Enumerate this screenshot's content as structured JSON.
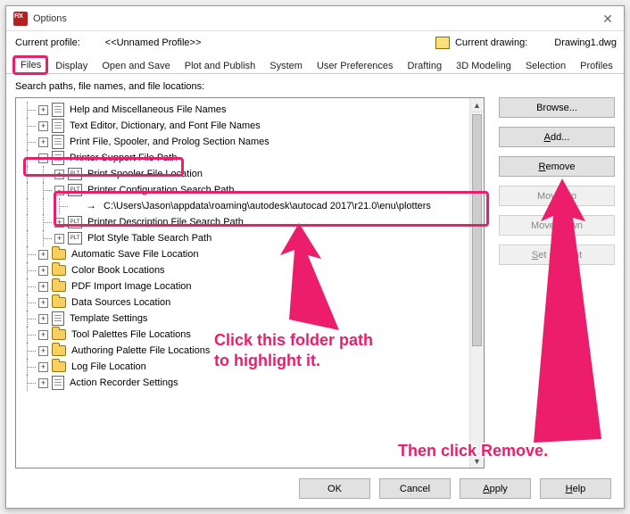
{
  "window": {
    "title": "Options"
  },
  "header": {
    "profile_label": "Current profile:",
    "profile_value": "<<Unnamed Profile>>",
    "drawing_label": "Current drawing:",
    "drawing_value": "Drawing1.dwg"
  },
  "tabs": {
    "items": [
      "Files",
      "Display",
      "Open and Save",
      "Plot and Publish",
      "System",
      "User Preferences",
      "Drafting",
      "3D Modeling",
      "Selection",
      "Profiles"
    ],
    "active": 0
  },
  "tree_label": "Search paths, file names, and file locations:",
  "tree": {
    "nodes": [
      {
        "depth": 0,
        "exp": "+",
        "icon": "doc",
        "label": "Help and Miscellaneous File Names"
      },
      {
        "depth": 0,
        "exp": "+",
        "icon": "doc",
        "label": "Text Editor, Dictionary, and Font File Names"
      },
      {
        "depth": 0,
        "exp": "+",
        "icon": "doc",
        "label": "Print File, Spooler, and Prolog Section Names"
      },
      {
        "depth": 0,
        "exp": "-",
        "icon": "doc",
        "label": "Printer Support File Path"
      },
      {
        "depth": 1,
        "exp": "+",
        "icon": "plt",
        "label": "Print Spooler File Location"
      },
      {
        "depth": 1,
        "exp": "-",
        "icon": "plt",
        "label": "Printer Configuration Search Path"
      },
      {
        "depth": 2,
        "exp": "",
        "icon": "arrow",
        "label": "C:\\Users\\Jason\\appdata\\roaming\\autodesk\\autocad 2017\\r21.0\\enu\\plotters"
      },
      {
        "depth": 1,
        "exp": "+",
        "icon": "plt",
        "label": "Printer Description File Search Path"
      },
      {
        "depth": 1,
        "exp": "+",
        "icon": "plt",
        "label": "Plot Style Table Search Path"
      },
      {
        "depth": 0,
        "exp": "+",
        "icon": "folder",
        "label": "Automatic Save File Location"
      },
      {
        "depth": 0,
        "exp": "+",
        "icon": "folder",
        "label": "Color Book Locations"
      },
      {
        "depth": 0,
        "exp": "+",
        "icon": "folder",
        "label": "PDF Import Image Location"
      },
      {
        "depth": 0,
        "exp": "+",
        "icon": "folder",
        "label": "Data Sources Location"
      },
      {
        "depth": 0,
        "exp": "+",
        "icon": "doc",
        "label": "Template Settings"
      },
      {
        "depth": 0,
        "exp": "+",
        "icon": "folder",
        "label": "Tool Palettes File Locations"
      },
      {
        "depth": 0,
        "exp": "+",
        "icon": "folder",
        "label": "Authoring Palette File Locations"
      },
      {
        "depth": 0,
        "exp": "+",
        "icon": "folder",
        "label": "Log File Location"
      },
      {
        "depth": 0,
        "exp": "+",
        "icon": "doc",
        "label": "Action Recorder Settings"
      }
    ]
  },
  "sidebuttons": {
    "browse": "Browse...",
    "add": "Add...",
    "remove": "Remove",
    "moveup": "Move Up",
    "movedown": "Move Down",
    "setcurrent": "Set Current"
  },
  "dlgbuttons": {
    "ok": "OK",
    "cancel": "Cancel",
    "apply": "Apply",
    "help": "Help"
  },
  "annotations": {
    "click_path": "Click this folder path\nto highlight it.",
    "then_remove": "Then click Remove."
  }
}
